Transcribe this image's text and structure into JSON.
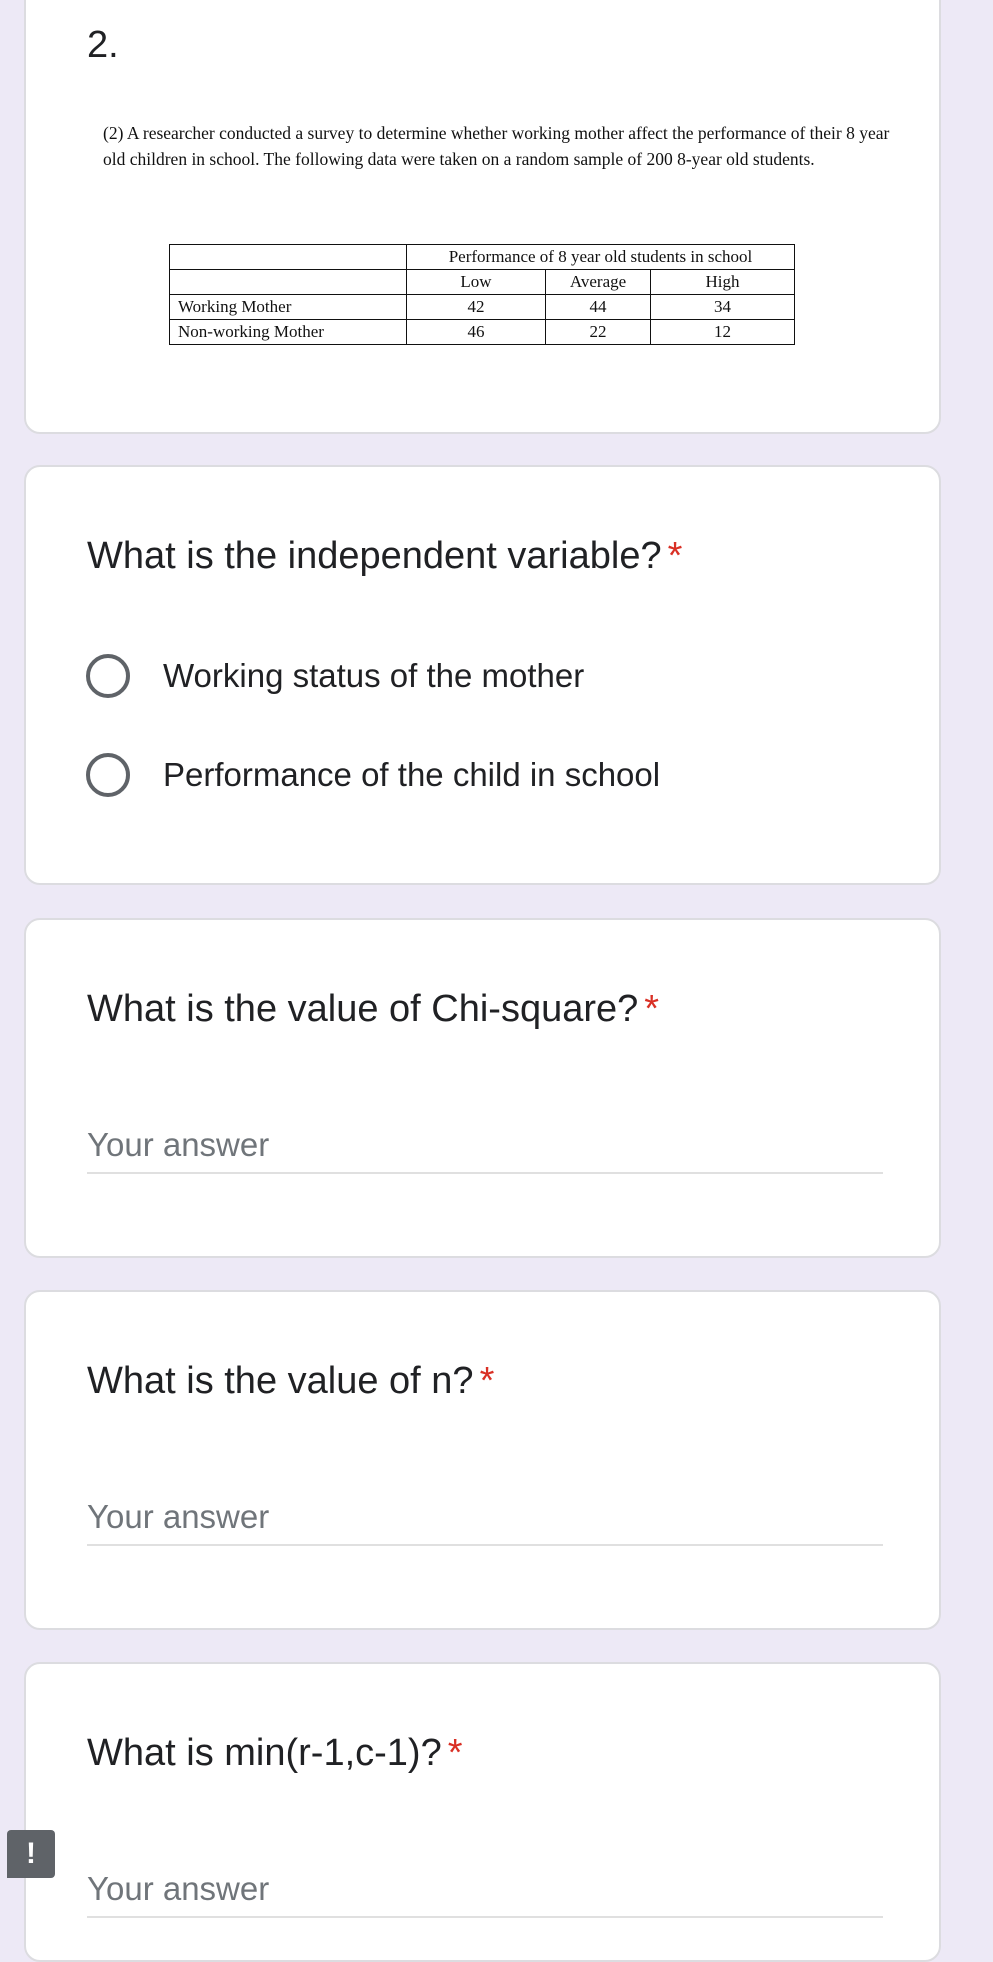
{
  "section": {
    "number": "2.",
    "paragraph": "(2) A researcher conducted a survey to determine whether working mother affect the performance of their 8 year old children in school. The following data were taken on a random sample of 200 8-year old students.",
    "table": {
      "group_header": "Performance of 8 year  old students in school",
      "columns": [
        "Low",
        "Average",
        "High"
      ],
      "rows": [
        {
          "label": "Working Mother",
          "values": [
            "42",
            "44",
            "34"
          ]
        },
        {
          "label": "Non-working Mother",
          "values": [
            "46",
            "22",
            "12"
          ]
        }
      ]
    }
  },
  "questions": [
    {
      "title": "What is the independent variable?",
      "required_mark": "*",
      "options": [
        "Working status of the mother",
        "Performance of the child in school"
      ]
    },
    {
      "title": "What is the value of Chi-square?",
      "required_mark": "*",
      "placeholder": "Your answer"
    },
    {
      "title": "What is the value of n?",
      "required_mark": "*",
      "placeholder": "Your answer"
    },
    {
      "title": "What is min(r-1,c-1)?",
      "required_mark": "*",
      "placeholder": "Your answer"
    }
  ],
  "feedback": {
    "icon": "report-icon",
    "glyph": "!"
  },
  "colors": {
    "background": "#ede9f6",
    "card": "#ffffff",
    "required": "#d93025",
    "radio_border": "#5f6368"
  }
}
